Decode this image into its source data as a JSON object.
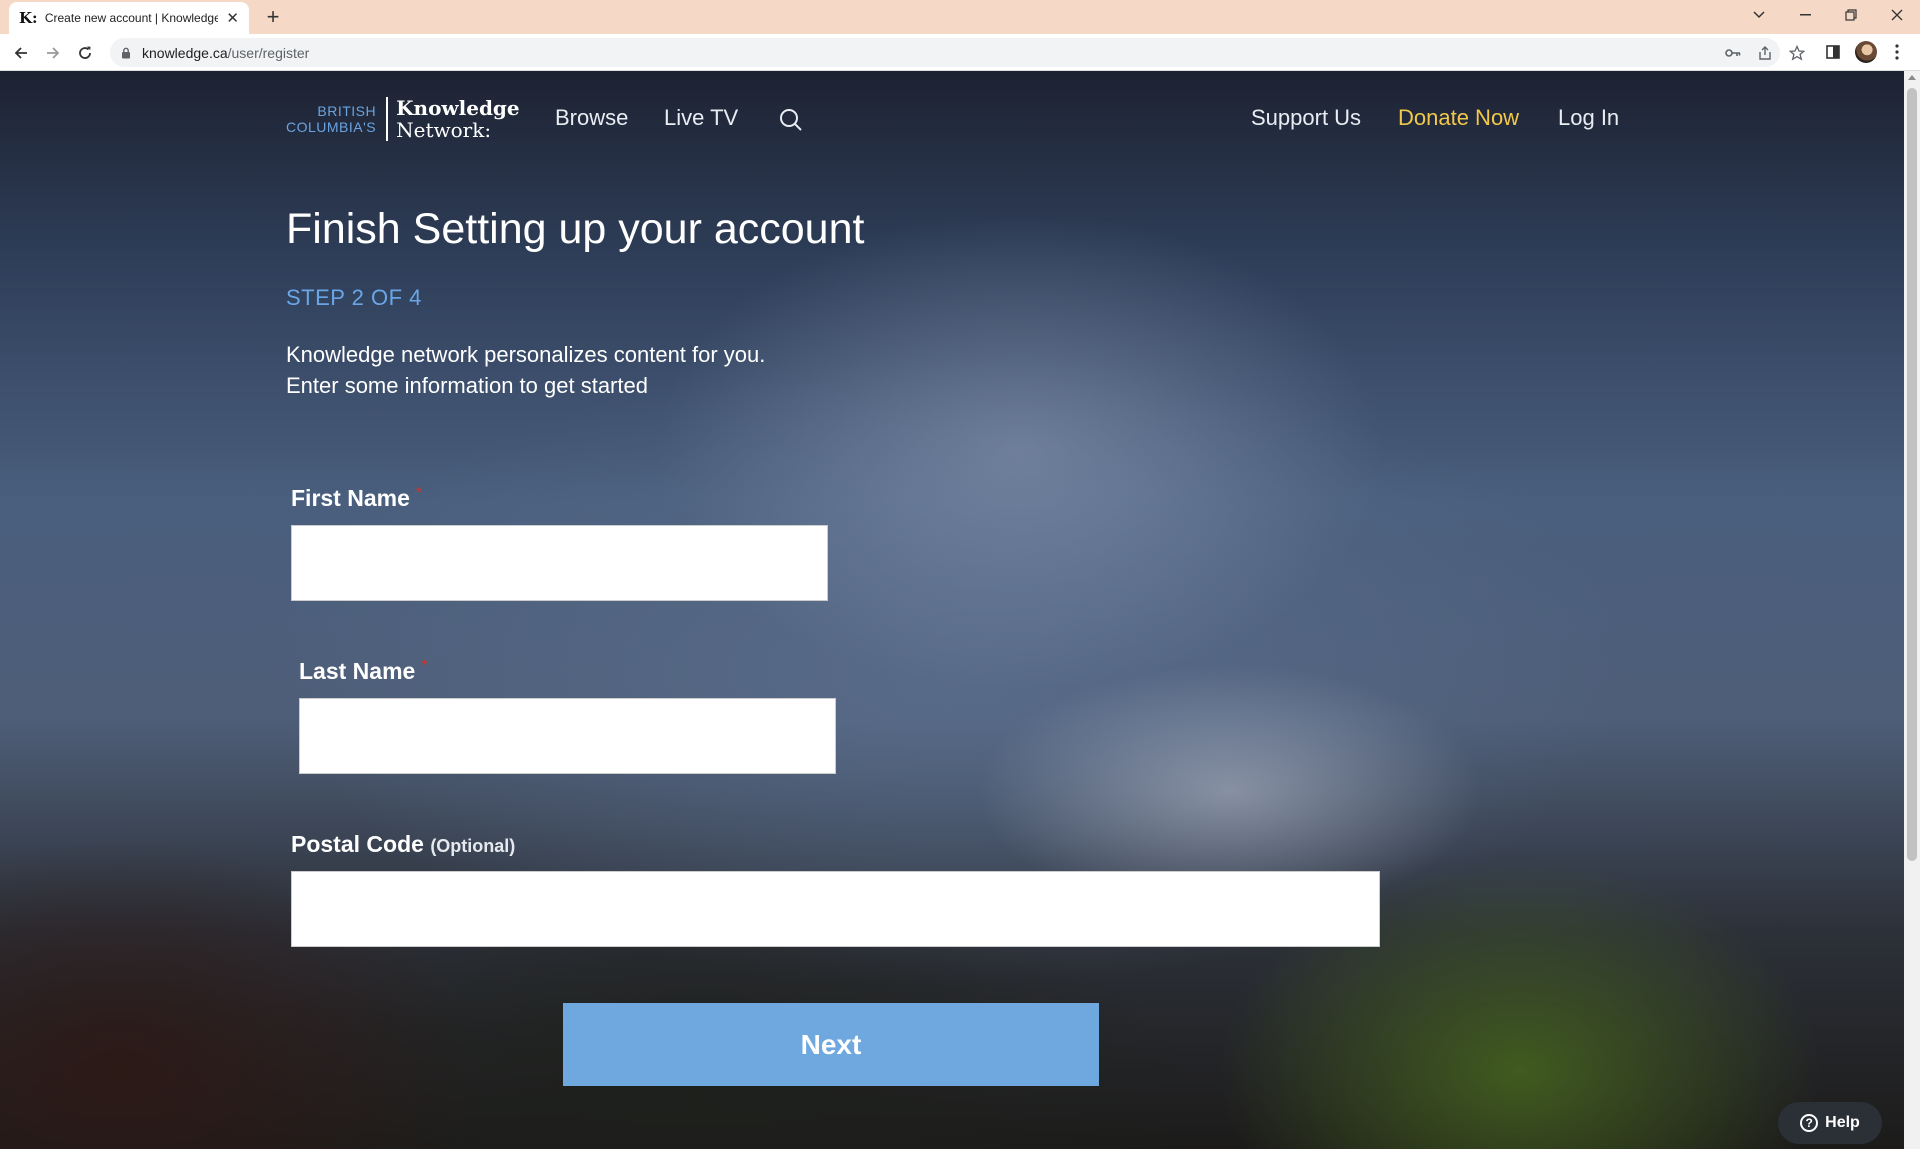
{
  "browser": {
    "tab": {
      "favicon": "K:",
      "title": "Create new account | Knowledge"
    },
    "address_bar": {
      "host": "knowledge.ca",
      "path": "/user/register"
    },
    "theme_color": "#f5d9c6"
  },
  "site": {
    "logo": {
      "line1": "BRITISH",
      "line2": "COLUMBIA'S",
      "brand1": "Knowledge",
      "brand2": "Network:"
    },
    "nav": {
      "browse": "Browse",
      "live_tv": "Live TV",
      "support": "Support Us",
      "donate": "Donate Now",
      "login": "Log In"
    },
    "accent_color": "#6fa8df",
    "donate_color": "#f2c84b"
  },
  "form": {
    "title": "Finish Setting up your account",
    "step": "STEP 2 OF 4",
    "intro_line1": "Knowledge network personalizes content for you.",
    "intro_line2": "Enter some information to get started",
    "first_name": {
      "label": "First Name",
      "required_mark": "*",
      "value": ""
    },
    "last_name": {
      "label": "Last Name",
      "required_mark": "*",
      "value": ""
    },
    "postal_code": {
      "label": "Postal Code",
      "optional": "(Optional)",
      "value": ""
    },
    "next_label": "Next"
  },
  "help": {
    "label": "Help",
    "icon": "question-circle-icon"
  }
}
